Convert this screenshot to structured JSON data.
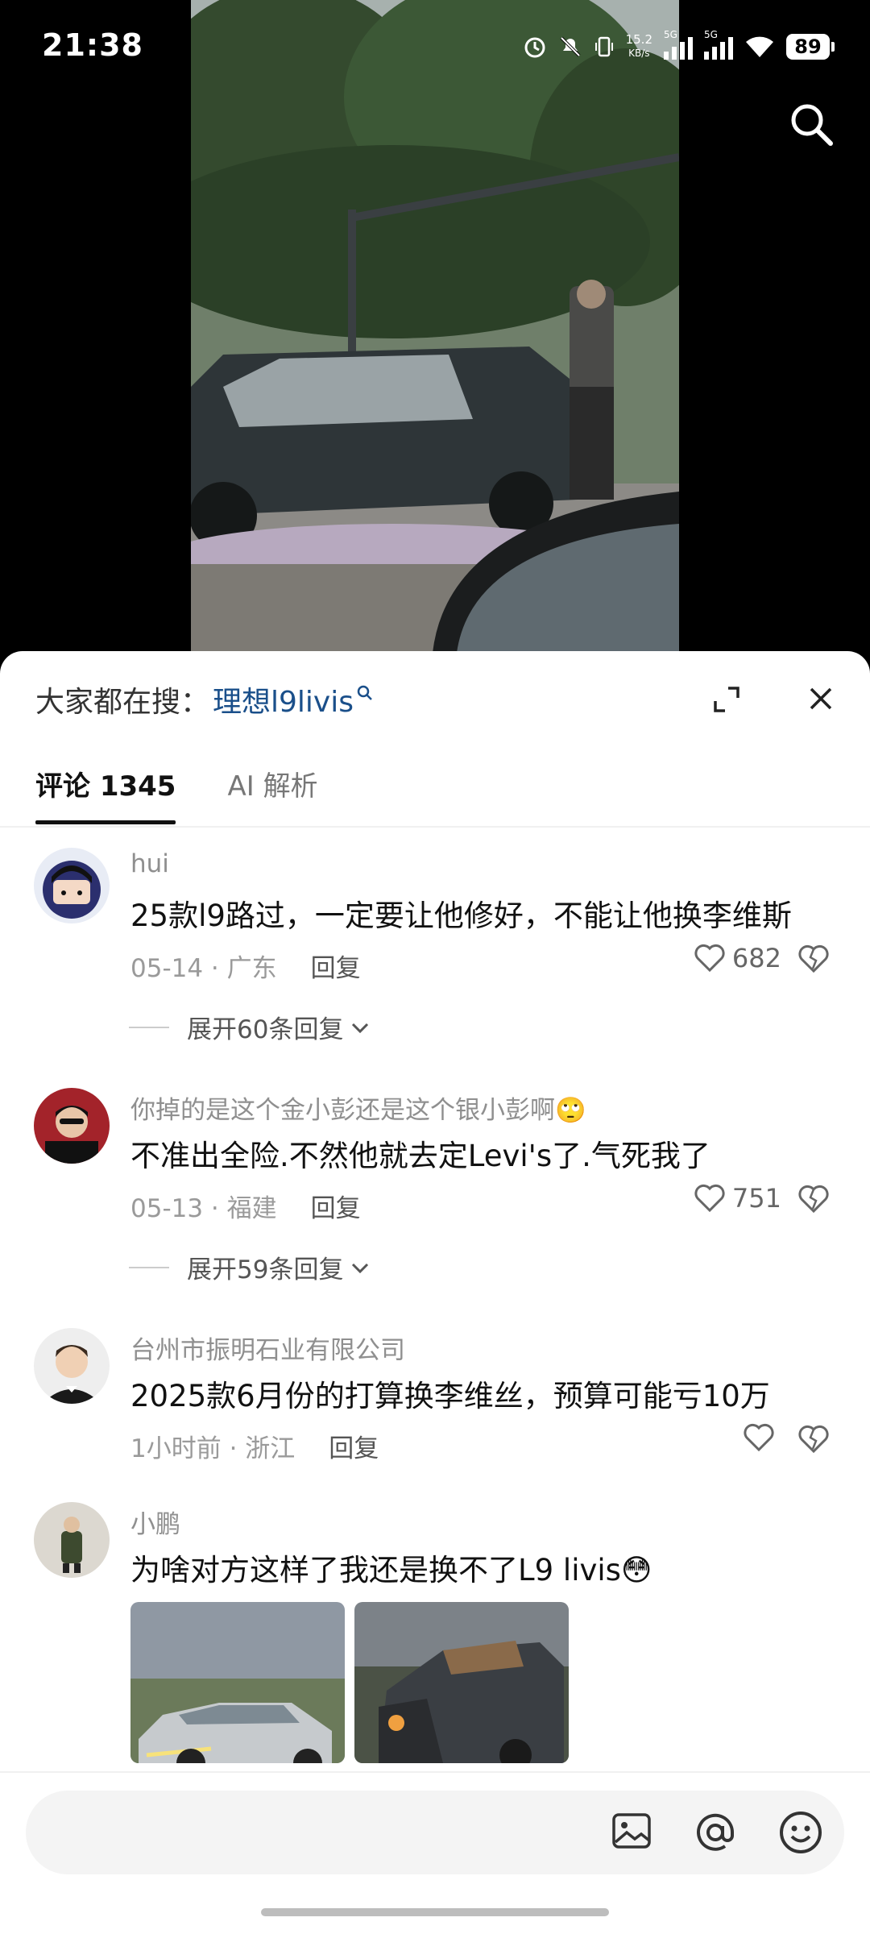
{
  "status_bar": {
    "time": "21:38",
    "net_speed_value": "15.2",
    "net_speed_unit": "KB/s",
    "signal_label_1": "5G",
    "signal_label_2": "5G",
    "battery": "89"
  },
  "video": {
    "description_icon": "search-icon"
  },
  "sheet": {
    "hot_search_prefix": "大家都在搜：",
    "hot_search_keyword": "理想l9livis",
    "tabs": [
      {
        "label": "评论 1345"
      },
      {
        "label": "AI 解析"
      }
    ]
  },
  "comments": [
    {
      "author": "hui",
      "text": "25款l9路过，一定要让他修好，不能让他换李维斯",
      "date_location": "05-14 · 广东",
      "reply_label": "回复",
      "likes": "682",
      "expand_label": "展开60条回复"
    },
    {
      "author": "你掉的是这个金小彭还是这个银小彭啊🙄",
      "text": "不准出全险.不然他就去定Levi's了.气死我了",
      "date_location": "05-13 · 福建",
      "reply_label": "回复",
      "likes": "751",
      "expand_label": "展开59条回复"
    },
    {
      "author": "台州市振明石业有限公司",
      "text": "2025款6月份的打算换李维丝，预算可能亏10万",
      "date_location": "1小时前 · 浙江",
      "reply_label": "回复",
      "likes": ""
    },
    {
      "author": "小鹏",
      "text": "为啥对方这样了我还是换不了L9 livis😳"
    }
  ],
  "input_bar": {
    "placeholder": ""
  },
  "colors": {
    "link": "#1a4f8a",
    "sheet_bg": "#ffffff",
    "screen_bg": "#000000"
  }
}
